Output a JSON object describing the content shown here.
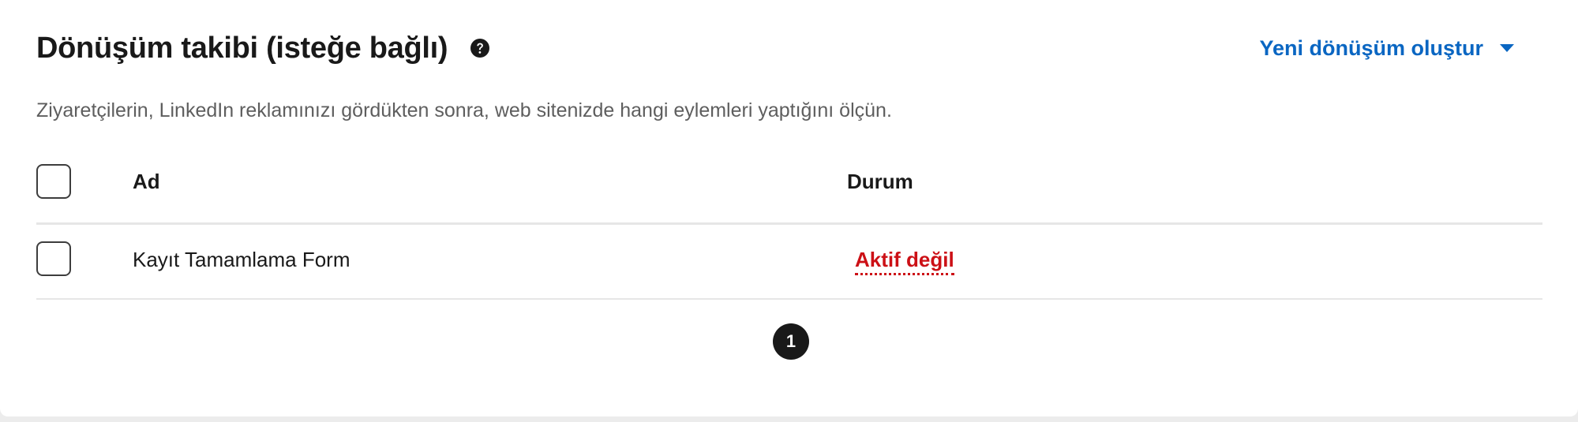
{
  "header": {
    "title": "Dönüşüm takibi (isteğe bağlı)",
    "help_icon": "question-circle-icon",
    "create_menu_label": "Yeni dönüşüm oluştur",
    "create_menu_icon": "caret-down-icon"
  },
  "description": "Ziyaretçilerin, LinkedIn reklamınızı gördükten sonra, web sitenizde hangi eylemleri yaptığını ölçün.",
  "table": {
    "columns": [
      "Ad",
      "Durum"
    ],
    "rows": [
      {
        "name": "Kayıt Tamamlama Form",
        "status": "Aktif değil"
      }
    ]
  },
  "pagination": {
    "current_page": "1"
  },
  "colors": {
    "accent": "#0a66c2",
    "status_inactive": "#cc1016",
    "text": "#191919",
    "muted": "#5e5e5e"
  }
}
